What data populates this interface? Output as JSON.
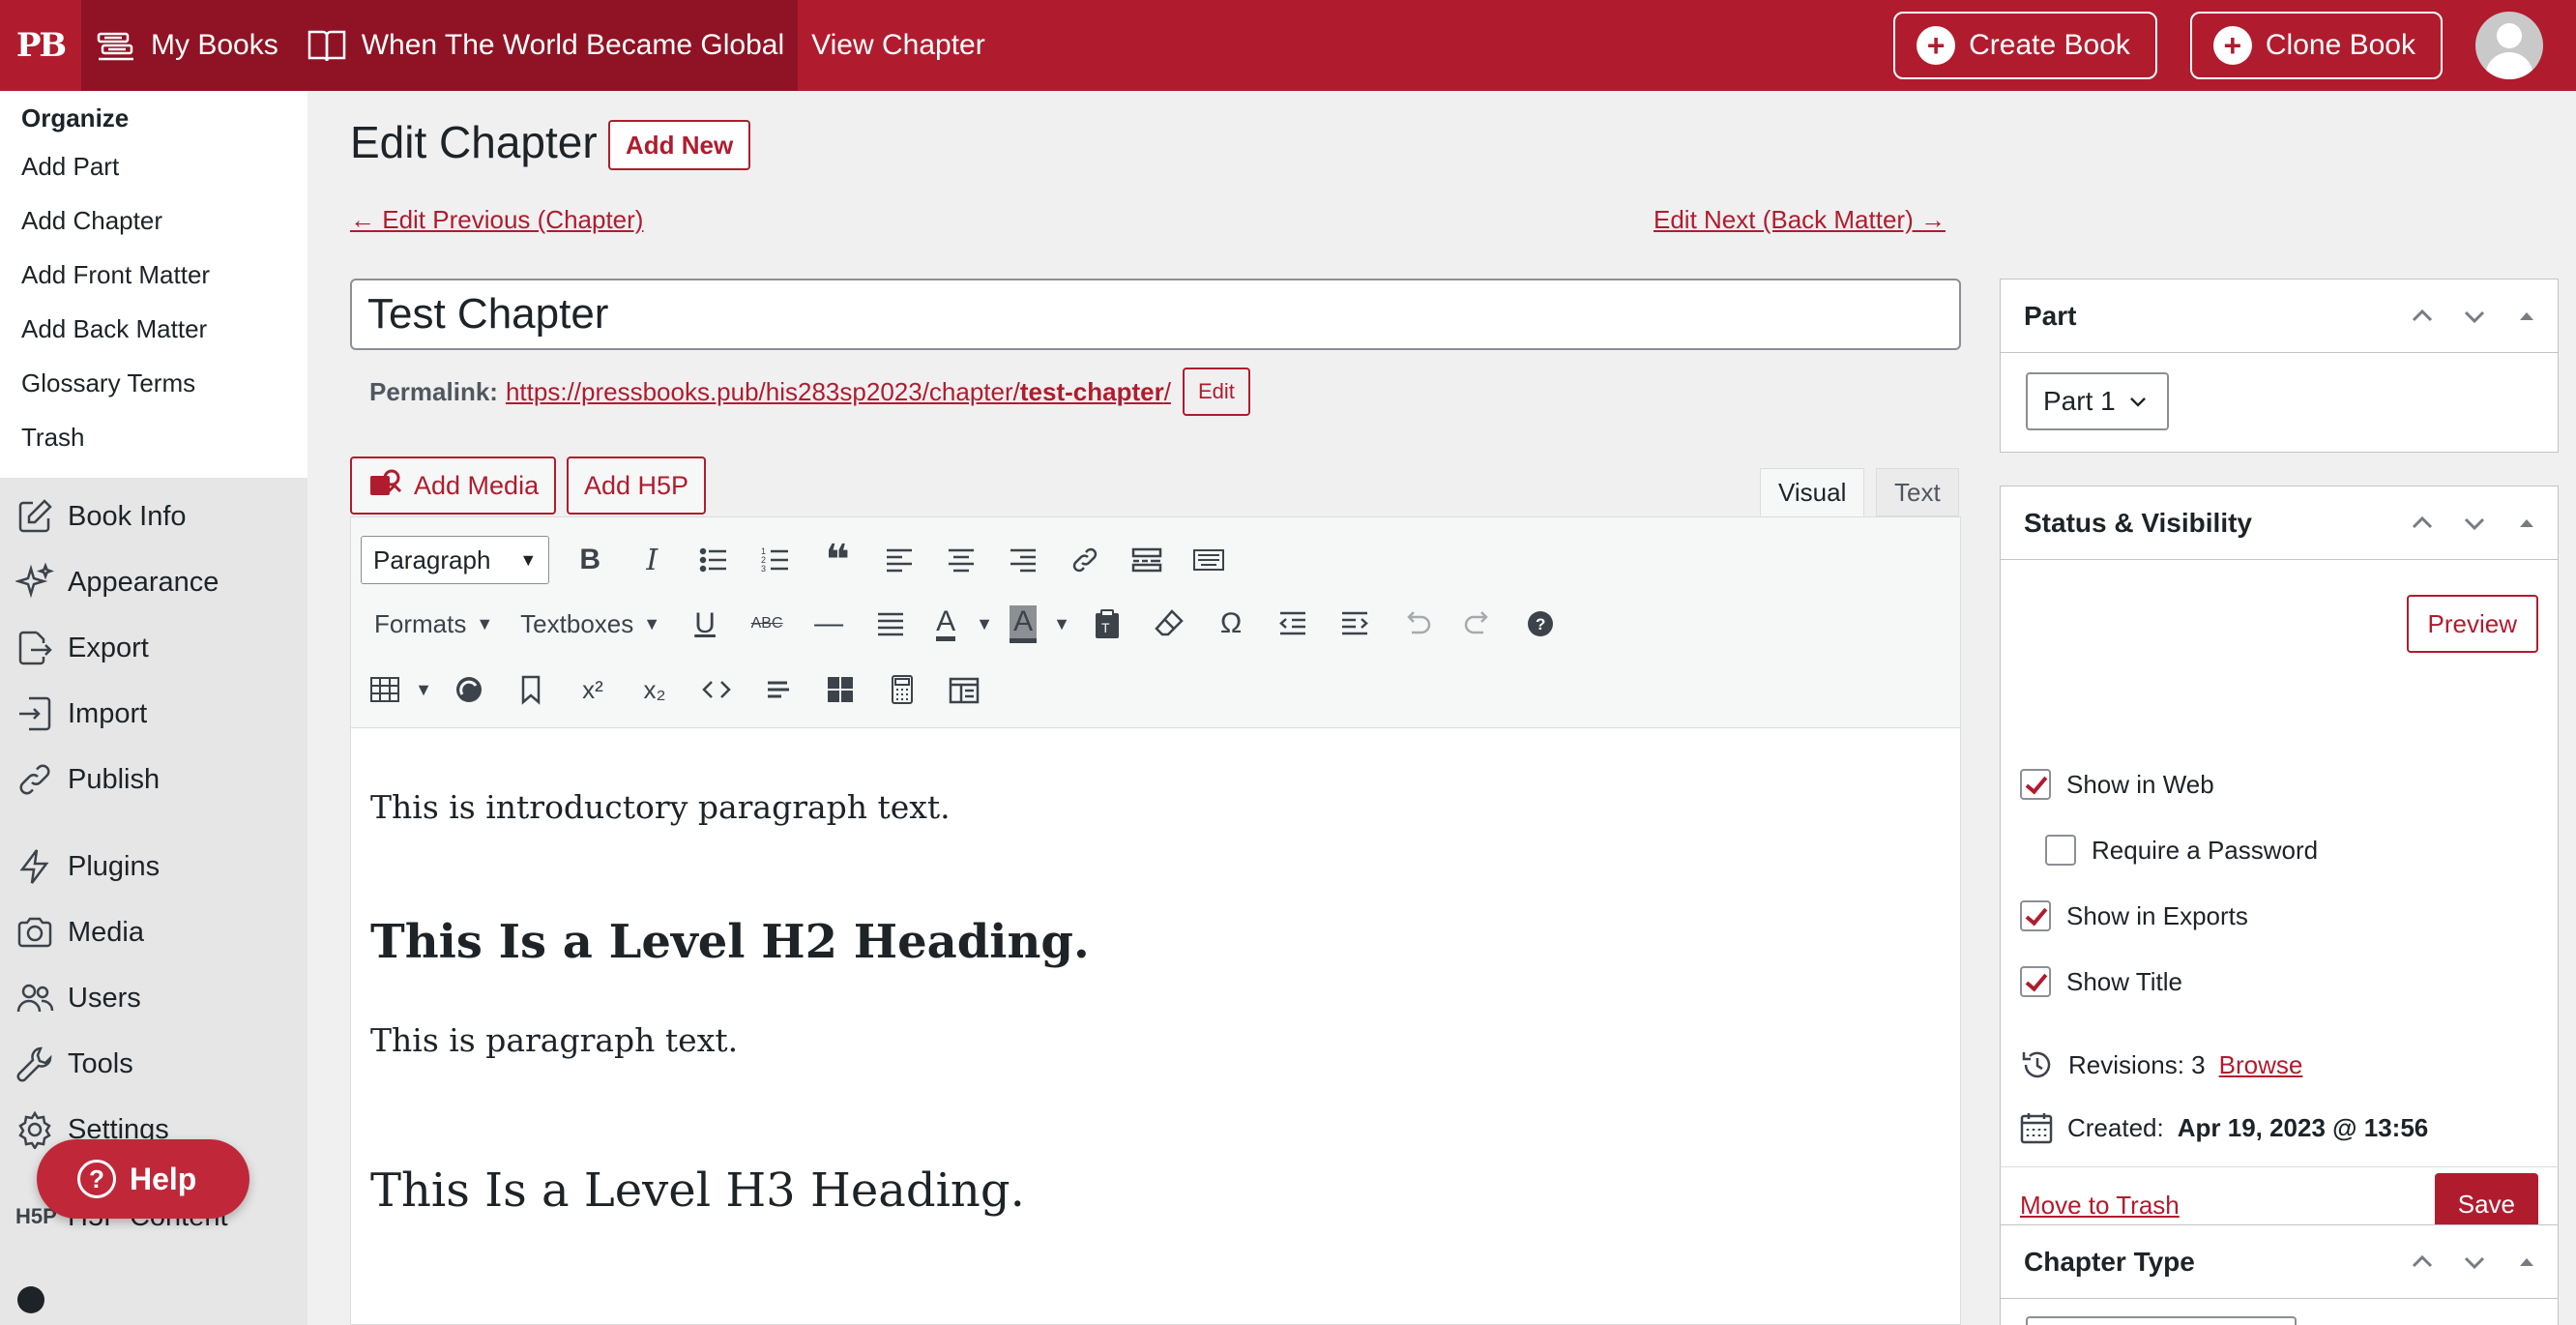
{
  "topbar": {
    "logo": "PB",
    "my_books": "My Books",
    "book_title": "When The World Became Global",
    "view_chapter": "View Chapter",
    "create_book": "Create Book",
    "clone_book": "Clone Book"
  },
  "sidebar": {
    "organize": "Organize",
    "sub_items": [
      "Add Part",
      "Add Chapter",
      "Add Front Matter",
      "Add Back Matter",
      "Glossary Terms",
      "Trash"
    ],
    "menu": [
      {
        "label": "Book Info",
        "icon": "edit-icon"
      },
      {
        "label": "Appearance",
        "icon": "sparkles-icon"
      },
      {
        "label": "Export",
        "icon": "export-icon"
      },
      {
        "label": "Import",
        "icon": "import-icon"
      },
      {
        "label": "Publish",
        "icon": "link-icon"
      },
      {
        "label": "Plugins",
        "icon": "bolt-icon"
      },
      {
        "label": "Media",
        "icon": "camera-icon"
      },
      {
        "label": "Users",
        "icon": "users-icon"
      },
      {
        "label": "Tools",
        "icon": "wrench-icon"
      },
      {
        "label": "Settings",
        "icon": "gear-icon"
      },
      {
        "label": "H5P Content",
        "icon": "h5p-icon"
      }
    ],
    "help": "Help"
  },
  "main": {
    "title": "Edit Chapter",
    "add_new": "Add New",
    "prev": "← Edit Previous (Chapter)",
    "next": "Edit Next (Back Matter) →",
    "chapter_title": "Test Chapter",
    "permalink_label": "Permalink:",
    "permalink_base": "https://pressbooks.pub/his283sp2023/chapter/",
    "permalink_slug": "test-chapter",
    "permalink_end": "/",
    "edit": "Edit",
    "add_media": "Add Media",
    "add_h5p": "Add H5P",
    "tab_visual": "Visual",
    "tab_text": "Text",
    "paragraph_select": "Paragraph",
    "formats": "Formats",
    "textboxes": "Textboxes",
    "content": {
      "p1": "This is introductory paragraph text.",
      "h2": "This Is a Level H2 Heading.",
      "p2": "This is paragraph text.",
      "h3": "This Is a Level H3 Heading."
    }
  },
  "panels": {
    "part": {
      "title": "Part",
      "value": "Part 1"
    },
    "status": {
      "title": "Status & Visibility",
      "preview": "Preview",
      "show_web": "Show in Web",
      "require_password": "Require a Password",
      "show_exports": "Show in Exports",
      "show_title": "Show Title",
      "revisions_label": "Revisions: 3",
      "browse": "Browse",
      "created_label": "Created:",
      "created_value": "Apr 19, 2023 @ 13:56",
      "trash": "Move to Trash",
      "save": "Save"
    },
    "chapter_type": {
      "title": "Chapter Type"
    }
  },
  "colors": {
    "accent": "#b01c2e",
    "accent_dark": "#8f1324"
  }
}
